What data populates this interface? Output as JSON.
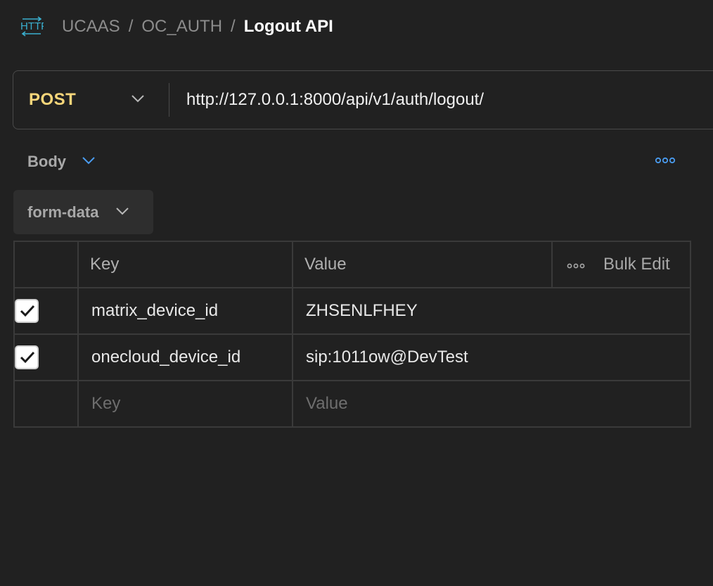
{
  "breadcrumb": {
    "icon": "http-icon",
    "items": [
      "UCAAS",
      "OC_AUTH"
    ],
    "current": "Logout API"
  },
  "request": {
    "method": "POST",
    "url": "http://127.0.0.1:8000/api/v1/auth/logout/"
  },
  "body": {
    "label": "Body",
    "form_type": "form-data"
  },
  "table": {
    "headers": {
      "key": "Key",
      "value": "Value",
      "bulk_edit": "Bulk Edit"
    },
    "rows": [
      {
        "checked": true,
        "key": "matrix_device_id",
        "value": "ZHSENLFHEY"
      },
      {
        "checked": true,
        "key": "onecloud_device_id",
        "value": "sip:1011ow@DevTest"
      }
    ],
    "placeholder": {
      "key": "Key",
      "value": "Value"
    }
  },
  "colors": {
    "background": "#212121",
    "method": "#f6d67a",
    "accent": "#4a9cf0",
    "http_icon": "#3ab0d0"
  }
}
